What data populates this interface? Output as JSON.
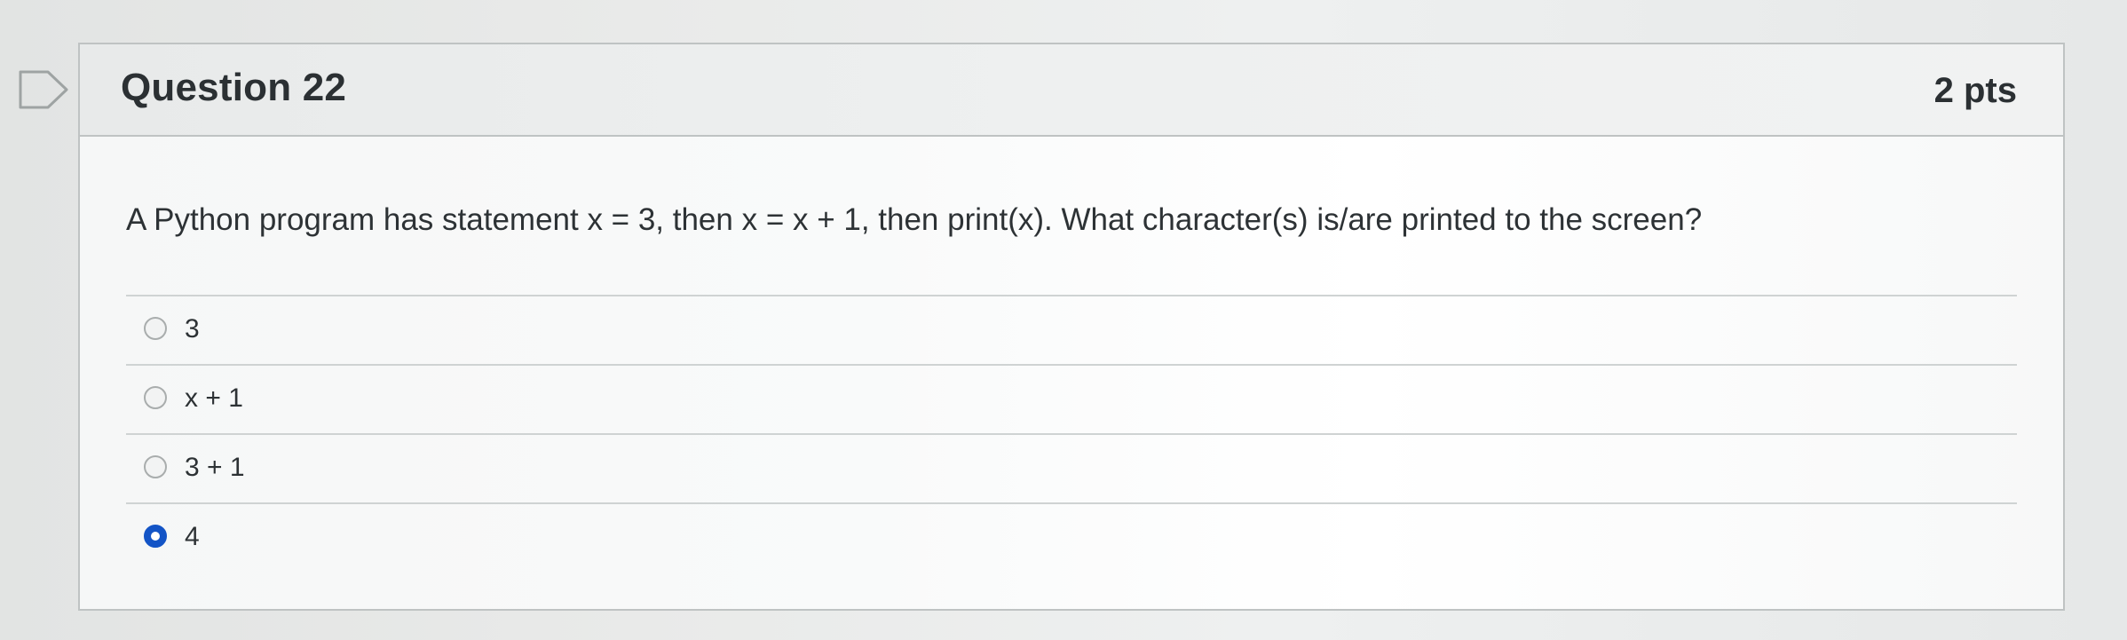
{
  "question": {
    "title": "Question 22",
    "points": "2 pts",
    "text": "A Python program has statement x = 3, then x = x + 1, then print(x). What character(s) is/are printed to the screen?"
  },
  "answers": [
    {
      "label": "3",
      "selected": false
    },
    {
      "label": "x + 1",
      "selected": false
    },
    {
      "label": "3 + 1",
      "selected": false
    },
    {
      "label": "4",
      "selected": true
    }
  ],
  "colors": {
    "accent": "#1354c6",
    "border": "#bfc3c3",
    "text": "#2d3235"
  },
  "icons": {
    "bookmark": "bookmark-flag-icon"
  }
}
